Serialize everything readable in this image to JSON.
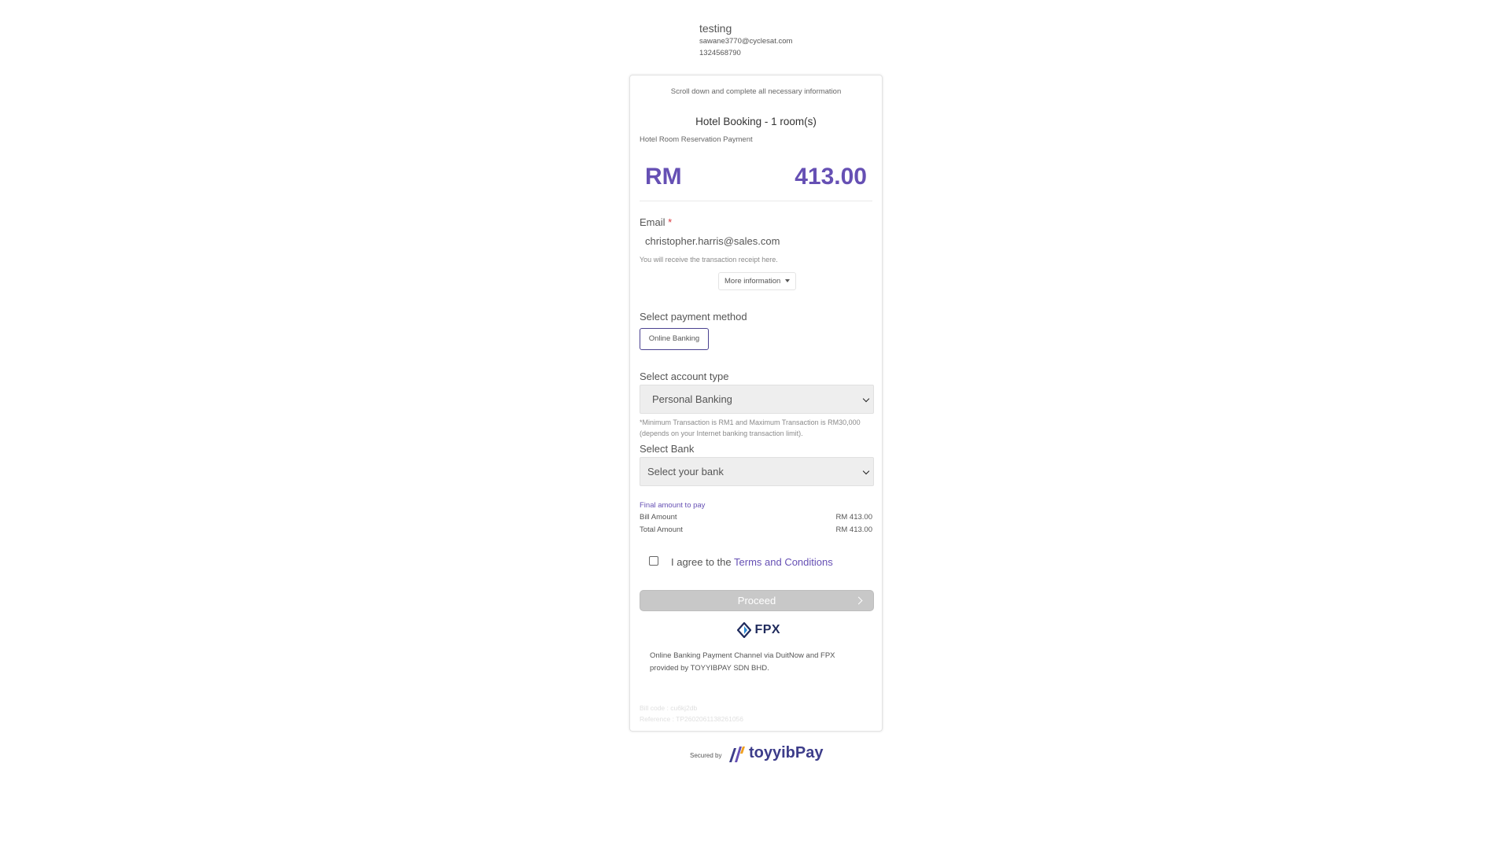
{
  "merchant": {
    "name": "testing",
    "email": "sawane3770@cyclesat.com",
    "phone": "1324568790"
  },
  "card": {
    "notice": "Scroll down and complete all necessary information",
    "title": "Hotel Booking - 1 room(s)",
    "subtitle": "Hotel Room Reservation Payment",
    "currency": "RM",
    "amount": "413.00"
  },
  "email_section": {
    "label": "Email",
    "required_mark": "*",
    "value": "christopher.harris@sales.com",
    "hint": "You will receive the transaction receipt here.",
    "more_info": "More information"
  },
  "payment_method": {
    "label": "Select payment method",
    "option": "Online Banking"
  },
  "account_type": {
    "label": "Select account type",
    "selected": "Personal Banking",
    "note": "*Minimum Transaction is RM1 and Maximum Transaction is RM30,000 (depends on your Internet banking transaction limit)."
  },
  "bank": {
    "label": "Select Bank",
    "placeholder": "Select your bank"
  },
  "summary": {
    "heading": "Final amount to pay",
    "bill_label": "Bill Amount",
    "bill_value": "RM 413.00",
    "total_label": "Total Amount",
    "total_value": "RM 413.00"
  },
  "terms": {
    "prefix": "I agree to the",
    "link": "Terms and Conditions"
  },
  "proceed_label": "Proceed",
  "fpx_logo_text": "FPX",
  "provider_text": "Online Banking Payment Channel via DuitNow and FPX provided by TOYYIBPAY SDN BHD.",
  "bill_code": "Bill code : cu6kj2db",
  "reference": "Reference : TP2602061138261056",
  "footer": {
    "secured_by": "Secured by",
    "brand": "toyyibPay"
  },
  "colors": {
    "accent": "#6650b4",
    "required": "#d9343a",
    "proceed_disabled": "#c8c8c8"
  }
}
